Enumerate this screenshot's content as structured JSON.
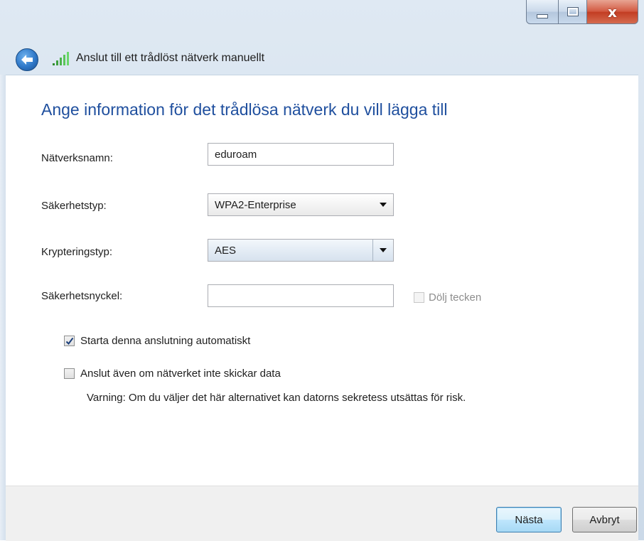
{
  "window": {
    "title": "Anslut till ett trådlöst nätverk manuellt",
    "caption_buttons": {
      "minimize": "minimize-icon",
      "maximize": "maximize-icon",
      "close": "close-icon",
      "close_glyph": "x"
    }
  },
  "heading": "Ange information för det trådlösa nätverk du vill lägga till",
  "form": {
    "network_name": {
      "label": "Nätverksnamn:",
      "value": "eduroam"
    },
    "security_type": {
      "label": "Säkerhetstyp:",
      "value": "WPA2-Enterprise"
    },
    "encryption_type": {
      "label": "Krypteringstyp:",
      "value": "AES"
    },
    "security_key": {
      "label": "Säkerhetsnyckel:",
      "value": ""
    },
    "hide_chars": {
      "label": "Dölj tecken",
      "checked": false,
      "enabled": false
    }
  },
  "options": {
    "auto_start": {
      "label": "Starta denna anslutning automatiskt",
      "checked": true
    },
    "connect_anyway": {
      "label": "Anslut även om nätverket inte skickar data",
      "checked": false
    },
    "warning": "Varning: Om du väljer det här alternativet kan datorns sekretess utsättas för risk."
  },
  "buttons": {
    "next": "Nästa",
    "cancel": "Avbryt"
  },
  "colors": {
    "heading": "#1f4f9e",
    "close_button": "#c23c22",
    "default_button_border": "#3c7fb1"
  }
}
